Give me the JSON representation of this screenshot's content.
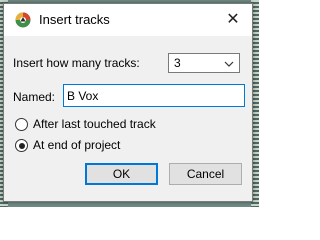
{
  "dialog": {
    "title": "Insert tracks",
    "app_icon": "reaper-logo-icon",
    "close_icon": "close-icon",
    "close_glyph": "✕"
  },
  "track_count": {
    "label": "Insert how many tracks:",
    "value": "3",
    "dropdown_icon": "chevron-down-icon"
  },
  "name": {
    "label": "Named:",
    "value": "B Vox"
  },
  "position": {
    "options": [
      {
        "label": "After last touched track",
        "selected": false
      },
      {
        "label": "At end of project",
        "selected": true
      }
    ]
  },
  "buttons": {
    "ok": "OK",
    "cancel": "Cancel"
  },
  "colors": {
    "accent": "#0078d7",
    "dialog_bg": "#f0f0f0",
    "logo_red": "#d8452b",
    "logo_green": "#3f8f4a"
  }
}
